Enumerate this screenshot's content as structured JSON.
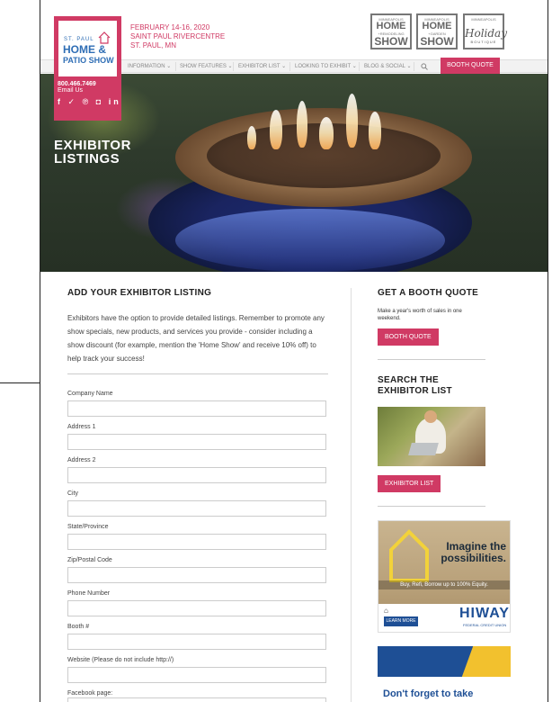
{
  "header": {
    "logo": {
      "line1": "ST. PAUL",
      "line2": "HOME &",
      "line3": "PATIO SHOW"
    },
    "dates": [
      "FEBRUARY 14-16, 2020",
      "SAINT PAUL RIVERCENTRE",
      "ST. PAUL, MN"
    ],
    "partners": [
      {
        "top": "MINNEAPOLIS",
        "main": "HOME",
        "mid": "+REMODELING",
        "bottom": "SHOW"
      },
      {
        "top": "MINNEAPOLIS",
        "main": "HOME",
        "mid": "+GARDEN",
        "bottom": "SHOW"
      },
      {
        "top": "MINNEAPOLIS",
        "main": "Holiday",
        "mid": "BOUTIQUE",
        "bottom": ""
      }
    ],
    "nav": [
      "INFORMATION",
      "SHOW FEATURES",
      "EXHIBITOR LIST",
      "LOOKING TO EXHIBIT",
      "BLOG & SOCIAL"
    ],
    "nav_search_icon": "search-icon",
    "booth_quote_label": "BOOTH QUOTE",
    "phone": "800.466.7469",
    "email": "Email Us",
    "social_icons": [
      "facebook-icon",
      "twitter-icon",
      "pinterest-icon",
      "instagram-icon",
      "linkedin-icon"
    ]
  },
  "hero": {
    "title_line1": "EXHIBITOR",
    "title_line2": "LISTINGS"
  },
  "main": {
    "heading": "ADD YOUR EXHIBITOR LISTING",
    "intro": "Exhibitors have the option to provide detailed listings. Remember to promote any show specials, new products, and services you provide - consider including a show discount (for example, mention the 'Home Show' and receive 10% off) to help track your success!",
    "fields": [
      {
        "label": "Company Name",
        "value": ""
      },
      {
        "label": "Address 1",
        "value": ""
      },
      {
        "label": "Address 2",
        "value": ""
      },
      {
        "label": "City",
        "value": ""
      },
      {
        "label": "State/Province",
        "value": ""
      },
      {
        "label": "Zip/Postal Code",
        "value": ""
      },
      {
        "label": "Phone Number",
        "value": ""
      },
      {
        "label": "Booth #",
        "value": ""
      },
      {
        "label": "Website (Please do not include http://)",
        "value": ""
      },
      {
        "label": "Facebook page:",
        "value": ""
      }
    ]
  },
  "sidebar": {
    "quote_heading": "GET A BOOTH QUOTE",
    "quote_text": "Make a year's worth of sales in one weekend.",
    "quote_button": "BOOTH QUOTE",
    "search_heading_line1": "SEARCH THE",
    "search_heading_line2": "EXHIBITOR LIST",
    "exhibitor_button": "EXHIBITOR LIST",
    "ad": {
      "headline_line1": "Imagine the",
      "headline_line2": "possibilities.",
      "tagline": "Buy, Refi, Borrow up to 100% Equity.",
      "learn_more": "LEARN MORE",
      "brand": "HIWAY",
      "brand_sub": "FEDERAL CREDIT UNION"
    },
    "footer_text": "Don't forget to take"
  },
  "colors": {
    "brand_pink": "#d03a64",
    "brand_blue": "#2f6eb5",
    "ad_blue": "#1e4f95"
  }
}
